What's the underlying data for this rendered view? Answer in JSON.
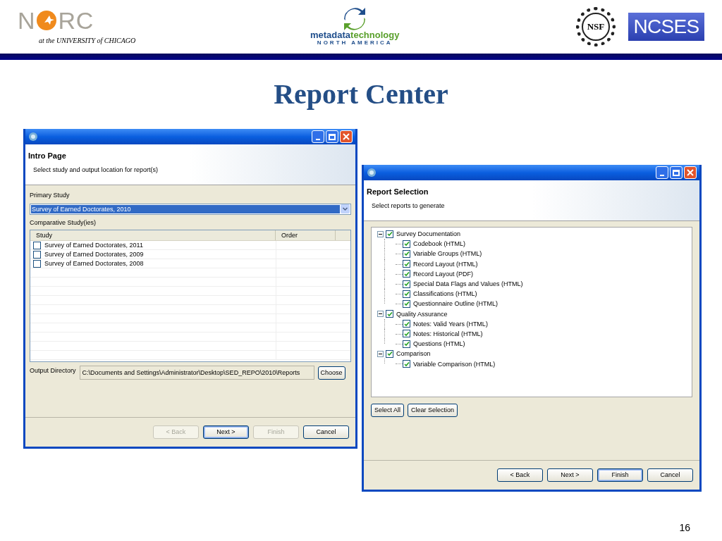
{
  "header": {
    "norc_logo": {
      "left": "N",
      "right": "RC",
      "tagline": "at the UNIVERSITY of CHICAGO"
    },
    "mtna_logo": {
      "word1": "metadata",
      "word2": "technology",
      "subline": "NORTH AMERICA"
    },
    "nsf_logo": "NSF",
    "ncses_logo": "NCSES"
  },
  "title": "Report Center",
  "intro_window": {
    "heading": "Intro Page",
    "description": "Select study and output location for report(s)",
    "primary_study": {
      "label": "Primary Study",
      "value": "Survey of Earned Doctorates, 2010"
    },
    "comparative": {
      "label": "Comparative Study(ies)",
      "columns": [
        "Study",
        "Order"
      ],
      "rows": [
        {
          "study": "Survey of Earned Doctorates, 2011",
          "checked": false
        },
        {
          "study": "Survey of Earned Doctorates, 2009",
          "checked": false
        },
        {
          "study": "Survey of Earned Doctorates, 2008",
          "checked": false
        }
      ]
    },
    "output_directory": {
      "label": "Output Directory",
      "value": "C:\\Documents and Settings\\Administrator\\Desktop\\SED_REPO\\2010\\Reports",
      "button": "Choose"
    },
    "buttons": [
      {
        "label": "< Back",
        "disabled": true,
        "default": false
      },
      {
        "label": "Next >",
        "disabled": false,
        "default": true
      },
      {
        "label": "Finish",
        "disabled": true,
        "default": false
      },
      {
        "label": "Cancel",
        "disabled": false,
        "default": false
      }
    ]
  },
  "report_window": {
    "heading": "Report Selection",
    "description": "Select reports to generate",
    "tree": [
      {
        "label": "Survey Documentation",
        "checked": true,
        "expanded": true,
        "children": [
          {
            "label": "Codebook (HTML)",
            "checked": true
          },
          {
            "label": "Variable Groups (HTML)",
            "checked": true
          },
          {
            "label": "Record Layout (HTML)",
            "checked": true
          },
          {
            "label": "Record Layout (PDF)",
            "checked": true
          },
          {
            "label": "Special Data Flags and Values (HTML)",
            "checked": true
          },
          {
            "label": "Classifications (HTML)",
            "checked": true
          },
          {
            "label": "Questionnaire Outline (HTML)",
            "checked": true
          }
        ]
      },
      {
        "label": "Quality Assurance",
        "checked": true,
        "expanded": true,
        "children": [
          {
            "label": "Notes: Valid Years (HTML)",
            "checked": true
          },
          {
            "label": "Notes: Historical (HTML)",
            "checked": true
          },
          {
            "label": "Questions (HTML)",
            "checked": true
          }
        ]
      },
      {
        "label": "Comparison",
        "checked": true,
        "expanded": true,
        "children": [
          {
            "label": "Variable Comparison (HTML)",
            "checked": true
          }
        ]
      }
    ],
    "selection_buttons": [
      "Select All",
      "Clear Selection"
    ],
    "buttons": [
      {
        "label": "< Back",
        "disabled": false,
        "default": false
      },
      {
        "label": "Next >",
        "disabled": false,
        "default": false
      },
      {
        "label": "Finish",
        "disabled": false,
        "default": true
      },
      {
        "label": "Cancel",
        "disabled": false,
        "default": false
      }
    ]
  },
  "page_number": "16"
}
